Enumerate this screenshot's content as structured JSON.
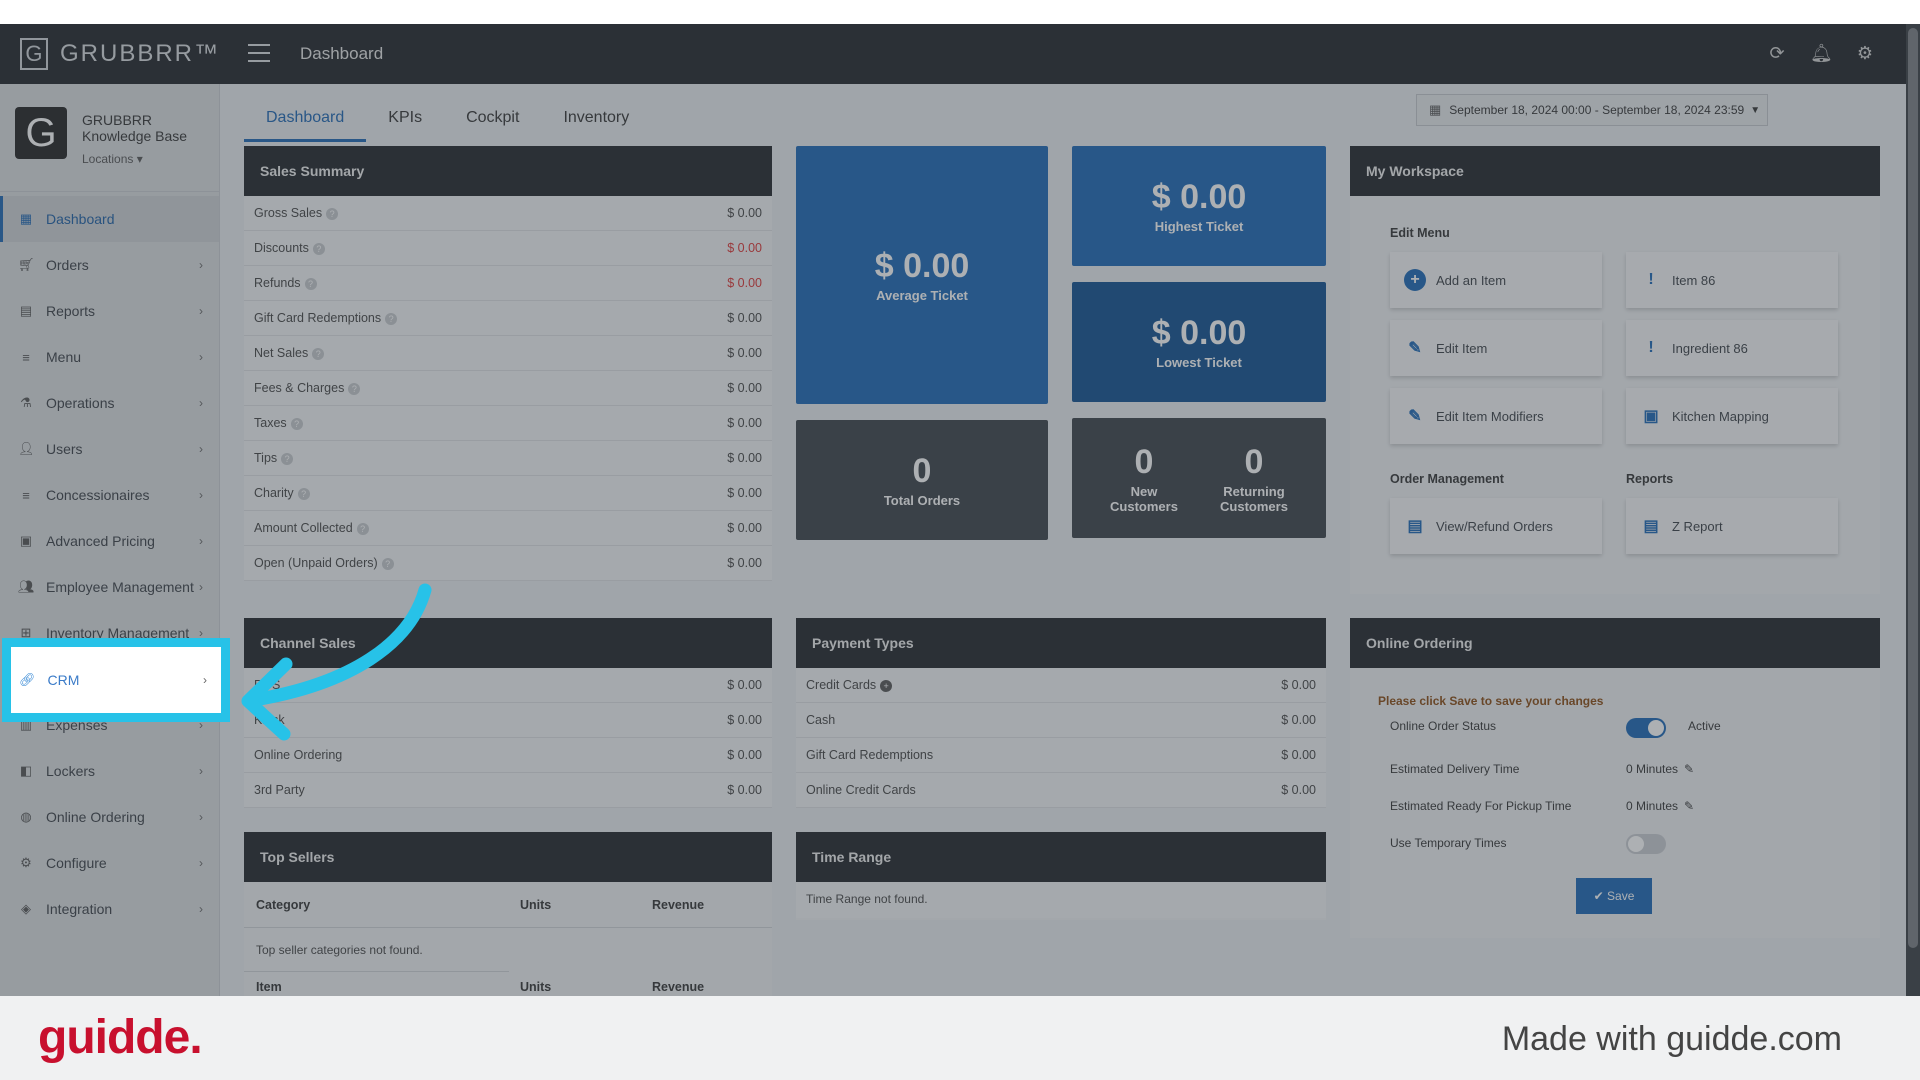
{
  "app": {
    "brand": "GRUBBRR™",
    "page_title": "Dashboard"
  },
  "profile": {
    "org": "GRUBBRR Knowledge Base",
    "locations": "Locations ▾"
  },
  "sidebar": {
    "items": [
      {
        "label": "Dashboard",
        "icon": "dashboard-icon",
        "active": true
      },
      {
        "label": "Orders",
        "icon": "cart-icon"
      },
      {
        "label": "Reports",
        "icon": "report-icon"
      },
      {
        "label": "Menu",
        "icon": "list-icon"
      },
      {
        "label": "Operations",
        "icon": "flask-icon"
      },
      {
        "label": "Users",
        "icon": "user-add-icon"
      },
      {
        "label": "Concessionaires",
        "icon": "list-icon"
      },
      {
        "label": "Advanced Pricing",
        "icon": "money-icon"
      },
      {
        "label": "Employee Management",
        "icon": "users-icon"
      },
      {
        "label": "Inventory Management",
        "icon": "sitemap-icon"
      },
      {
        "label": "CRM",
        "icon": "link-icon",
        "highlighted": true
      },
      {
        "label": "Expenses",
        "icon": "chart-icon"
      },
      {
        "label": "Lockers",
        "icon": "locker-icon"
      },
      {
        "label": "Online Ordering",
        "icon": "globe-icon"
      },
      {
        "label": "Configure",
        "icon": "gear-icon"
      },
      {
        "label": "Integration",
        "icon": "integration-icon"
      }
    ]
  },
  "tabs": [
    "Dashboard",
    "KPIs",
    "Cockpit",
    "Inventory"
  ],
  "date_range": "September 18, 2024 00:00 - September 18, 2024 23:59",
  "sales_summary": {
    "title": "Sales Summary",
    "rows": [
      {
        "label": "Gross Sales",
        "value": "$ 0.00",
        "red": false
      },
      {
        "label": "Discounts",
        "value": "$ 0.00",
        "red": true
      },
      {
        "label": "Refunds",
        "value": "$ 0.00",
        "red": true
      },
      {
        "label": "Gift Card Redemptions",
        "value": "$ 0.00",
        "red": false
      },
      {
        "label": "Net Sales",
        "value": "$ 0.00",
        "red": false
      },
      {
        "label": "Fees & Charges",
        "value": "$ 0.00",
        "red": false
      },
      {
        "label": "Taxes",
        "value": "$ 0.00",
        "red": false
      },
      {
        "label": "Tips",
        "value": "$ 0.00",
        "red": false
      },
      {
        "label": "Charity",
        "value": "$ 0.00",
        "red": false
      },
      {
        "label": "Amount Collected",
        "value": "$ 0.00",
        "red": false
      },
      {
        "label": "Open (Unpaid Orders)",
        "value": "$ 0.00",
        "red": false
      }
    ]
  },
  "tiles": {
    "average": {
      "value": "$ 0.00",
      "label": "Average Ticket"
    },
    "highest": {
      "value": "$ 0.00",
      "label": "Highest Ticket"
    },
    "lowest": {
      "value": "$ 0.00",
      "label": "Lowest Ticket"
    },
    "total_orders": {
      "value": "0",
      "label": "Total Orders"
    },
    "new_customers": {
      "value": "0",
      "label": "New Customers"
    },
    "returning_customers": {
      "value": "0",
      "label": "Returning Customers"
    }
  },
  "workspace": {
    "title": "My Workspace",
    "edit_menu_label": "Edit Menu",
    "order_mgmt_label": "Order Management",
    "reports_label": "Reports",
    "buttons": {
      "add_item": "Add an Item",
      "item86": "Item 86",
      "edit_item": "Edit Item",
      "ingredient86": "Ingredient 86",
      "edit_modifiers": "Edit Item Modifiers",
      "kitchen_mapping": "Kitchen Mapping",
      "view_refund": "View/Refund Orders",
      "z_report": "Z Report"
    }
  },
  "channel_sales": {
    "title": "Channel Sales",
    "rows": [
      {
        "label": "POS",
        "value": "$ 0.00"
      },
      {
        "label": "Kiosk",
        "value": "$ 0.00"
      },
      {
        "label": "Online Ordering",
        "value": "$ 0.00"
      },
      {
        "label": "3rd Party",
        "value": "$ 0.00"
      }
    ]
  },
  "payment_types": {
    "title": "Payment Types",
    "rows": [
      {
        "label": "Credit Cards",
        "value": "$ 0.00",
        "plus": true
      },
      {
        "label": "Cash",
        "value": "$ 0.00"
      },
      {
        "label": "Gift Card Redemptions",
        "value": "$ 0.00"
      },
      {
        "label": "Online Credit Cards",
        "value": "$ 0.00"
      }
    ]
  },
  "online_ordering": {
    "title": "Online Ordering",
    "notice": "Please click Save to save your changes",
    "status_label": "Online Order Status",
    "status_value": "Active",
    "delivery_label": "Estimated Delivery Time",
    "delivery_value": "0 Minutes",
    "pickup_label": "Estimated Ready For Pickup Time",
    "pickup_value": "0 Minutes",
    "temp_label": "Use Temporary Times",
    "save": "✔ Save"
  },
  "top_sellers": {
    "title": "Top Sellers",
    "headers": [
      "Category",
      "Units",
      "Revenue"
    ],
    "empty": "Top seller categories not found.",
    "headers2": [
      "Item",
      "Units",
      "Revenue"
    ]
  },
  "time_range": {
    "title": "Time Range",
    "empty": "Time Range not found."
  },
  "footer": {
    "logo": "guidde.",
    "made_with": "Made with guidde.com"
  },
  "colors": {
    "accent": "#1a67b5",
    "highlight": "#27c2e8",
    "brand_red": "#c8102e"
  }
}
